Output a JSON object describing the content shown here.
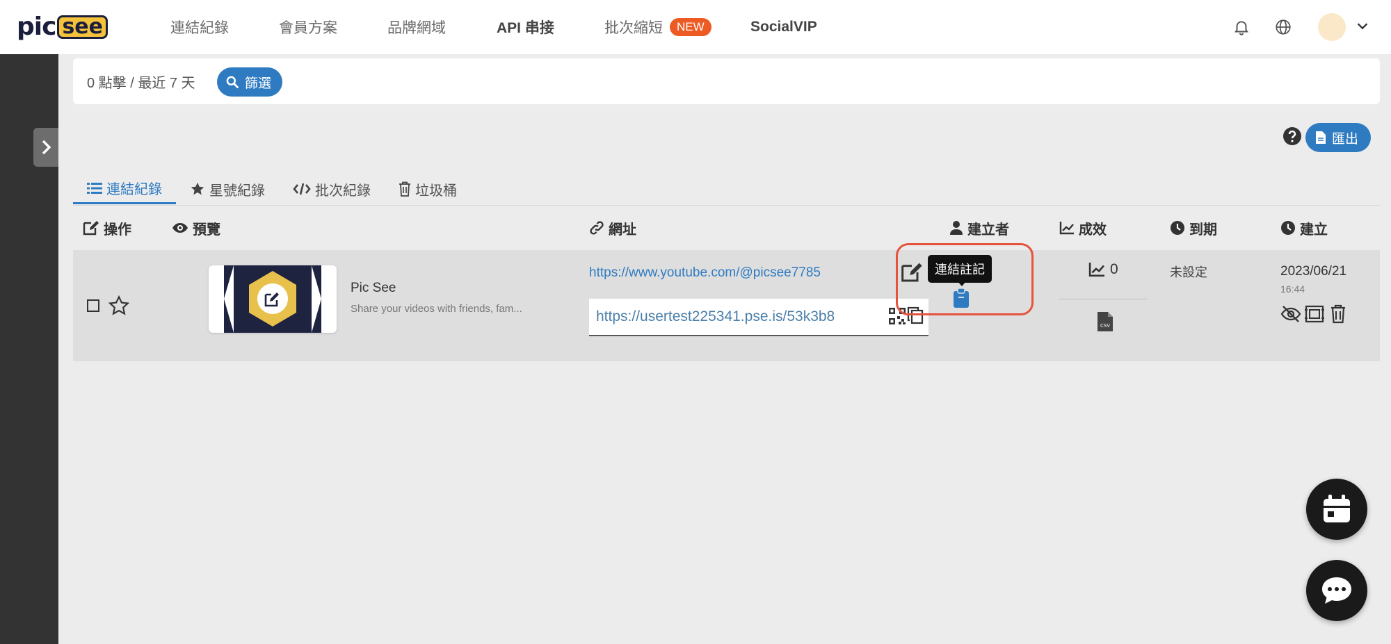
{
  "brand": {
    "pic": "pic",
    "see": "see",
    "accent": "#2f7bc1",
    "highlight": "#e5533d"
  },
  "nav": {
    "links": [
      "連結紀錄",
      "會員方案",
      "品牌網域",
      "API 串接",
      "批次縮短",
      "SocialVIP"
    ],
    "new_badge": "NEW",
    "icons": [
      "bell-icon",
      "globe-icon",
      "avatar",
      "chevron-down-icon"
    ]
  },
  "filter": {
    "summary": "0 點擊 / 最近 7 天",
    "button_label": "篩選"
  },
  "toolbar": {
    "export_label": "匯出"
  },
  "tabs": [
    {
      "label": "連結紀錄",
      "icon": "list-icon",
      "active": true
    },
    {
      "label": "星號紀錄",
      "icon": "star-icon",
      "active": false
    },
    {
      "label": "批次紀錄",
      "icon": "code-icon",
      "active": false
    },
    {
      "label": "垃圾桶",
      "icon": "trash-icon",
      "active": false
    }
  ],
  "columns": [
    {
      "label": "操作",
      "icon": "edit-icon"
    },
    {
      "label": "預覽",
      "icon": "eye-icon"
    },
    {
      "label": "網址",
      "icon": "link-icon"
    },
    {
      "label": "建立者",
      "icon": "user-icon"
    },
    {
      "label": "成效",
      "icon": "chart-icon"
    },
    {
      "label": "到期",
      "icon": "clock-icon"
    },
    {
      "label": "建立",
      "icon": "clock-icon"
    }
  ],
  "row": {
    "preview_title": "Pic See",
    "preview_description": "Share your videos with friends, fam...",
    "destination_url": "https://www.youtube.com/@picsee7785",
    "short_url": "https://usertest225341.pse.is/53k3b8",
    "tooltip": "連結註記",
    "clicks": "0",
    "expiry": "未設定",
    "created_date": "2023/06/21",
    "created_time": "16:44"
  }
}
